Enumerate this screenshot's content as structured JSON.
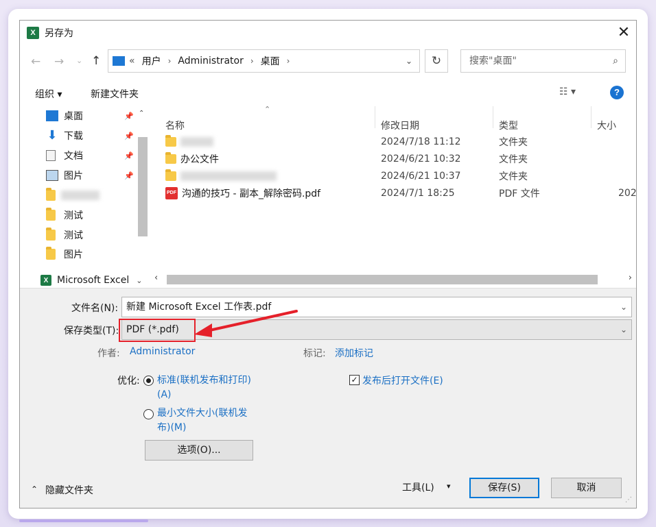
{
  "window": {
    "title": "另存为",
    "app_icon": "excel-icon"
  },
  "address": {
    "parts": [
      "用户",
      "Administrator",
      "桌面"
    ],
    "chevron": "«"
  },
  "search": {
    "placeholder": "搜索\"桌面\""
  },
  "toolbar": {
    "organize": "组织 ▾",
    "new_folder": "新建文件夹",
    "help": "?"
  },
  "nav": {
    "items": [
      {
        "label": "桌面",
        "icon": "desktop-icon",
        "pinned": true
      },
      {
        "label": "下载",
        "icon": "download-icon",
        "pinned": true
      },
      {
        "label": "文档",
        "icon": "document-icon",
        "pinned": true
      },
      {
        "label": "图片",
        "icon": "pictures-icon",
        "pinned": true
      },
      {
        "label": "",
        "icon": "folder-icon",
        "blurred": true
      },
      {
        "label": "测试",
        "icon": "folder-icon"
      },
      {
        "label": "测试",
        "icon": "folder-icon"
      },
      {
        "label": "图片",
        "icon": "folder-icon"
      }
    ],
    "app_entry": "Microsoft Excel"
  },
  "columns": {
    "name": "名称",
    "date": "修改日期",
    "type": "类型",
    "size": "大小"
  },
  "files": [
    {
      "name": "",
      "blurred": true,
      "date": "2024/7/18 11:12",
      "type": "文件夹",
      "size": ""
    },
    {
      "name": "办公文件",
      "date": "2024/6/21 10:32",
      "type": "文件夹",
      "size": ""
    },
    {
      "name": "",
      "blurred": true,
      "date": "2024/6/21 10:37",
      "type": "文件夹",
      "size": ""
    },
    {
      "name": "沟通的技巧 - 副本_解除密码.pdf",
      "date": "2024/7/1 18:25",
      "type": "PDF 文件",
      "size": "202"
    }
  ],
  "form": {
    "filename_label": "文件名(N):",
    "filename_value": "新建 Microsoft Excel 工作表.pdf",
    "filetype_label": "保存类型(T):",
    "filetype_value": "PDF (*.pdf)",
    "author_label": "作者:",
    "author_value": "Administrator",
    "tags_label": "标记:",
    "tags_value": "添加标记",
    "optimize_label": "优化:",
    "opt_standard_line1": "标准(联机发布和打印)",
    "opt_standard_line2": "(A)",
    "opt_min_line1": "最小文件大小(联机发",
    "opt_min_line2": "布)(M)",
    "options_button": "选项(O)...",
    "open_after": "发布后打开文件(E)",
    "open_after_checked": true,
    "selected_optimization": "standard"
  },
  "footer": {
    "hide_folders": "隐藏文件夹",
    "tools": "工具(L)",
    "save": "保存(S)",
    "cancel": "取消"
  },
  "colors": {
    "accent": "#0078d7",
    "highlight": "#e5202a",
    "link": "#1a6fc4"
  }
}
